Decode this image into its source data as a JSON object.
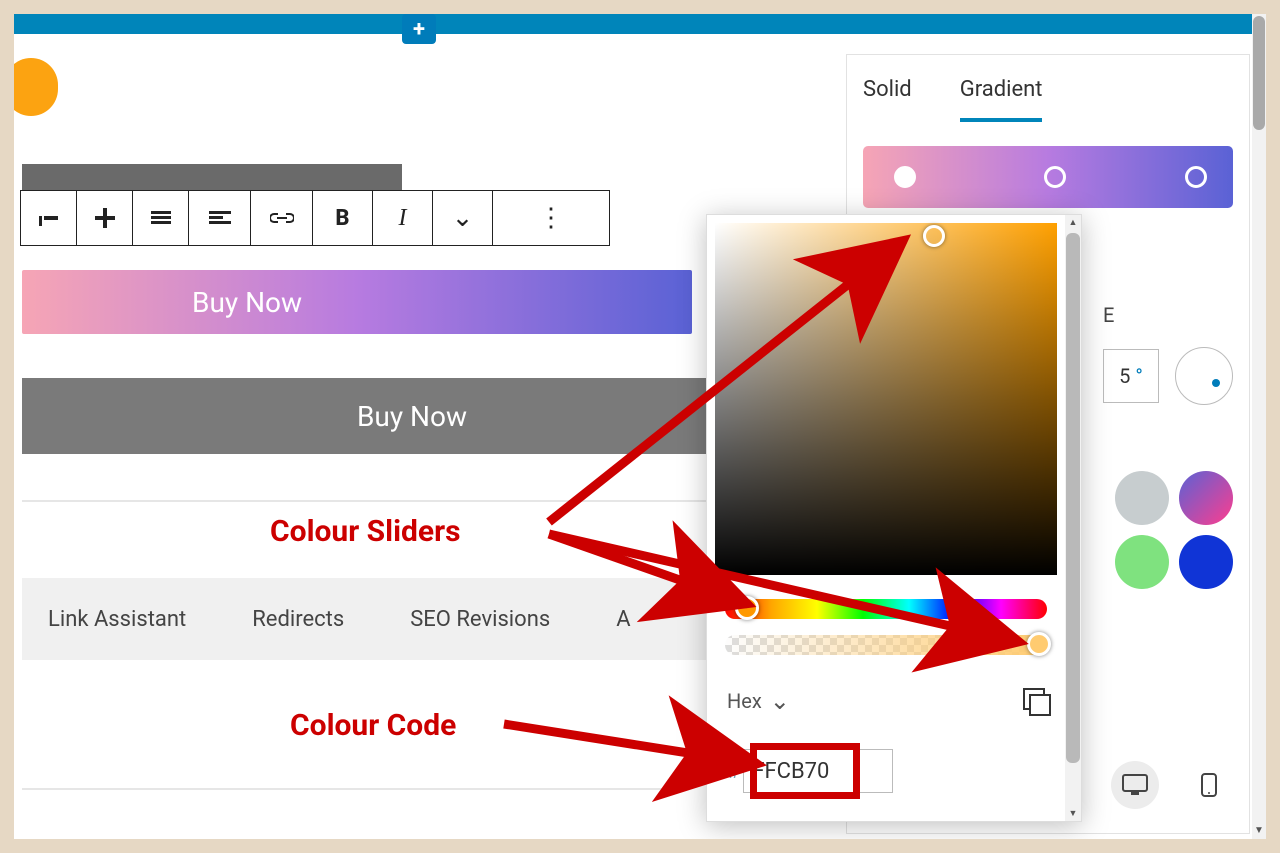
{
  "header": {
    "plus_symbol": "+"
  },
  "toolbar": {
    "bold": "B",
    "italic": "I",
    "chevron": "⌄",
    "more": "⋮"
  },
  "buttons": {
    "buy_now_1": "Buy Now",
    "buy_now_2": "Buy Now"
  },
  "annotations": {
    "sliders": "Colour Sliders",
    "code": "Colour Code"
  },
  "bottom_tabs": {
    "link_assistant": "Link Assistant",
    "redirects": "Redirects",
    "seo_revisions": "SEO Revisions",
    "a_partial": "A"
  },
  "sidebar": {
    "tab_solid": "Solid",
    "tab_gradient": "Gradient",
    "angle_label_partial": "E",
    "angle_value": "5",
    "angle_unit": "°"
  },
  "picker": {
    "format_label": "Hex",
    "format_chevron": "⌄",
    "hash": "#",
    "hex_value": "FFCB70"
  },
  "colors": {
    "swatch1": "#c7cdcf",
    "swatch2_gradient_from": "#5a62d5",
    "swatch2_gradient_to": "#ff3d8e",
    "swatch3": "#7fe27f",
    "swatch4": "#1034d6"
  }
}
